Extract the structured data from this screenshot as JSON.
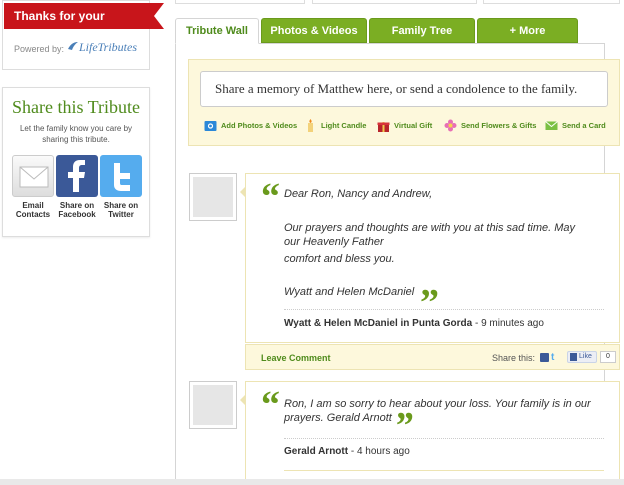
{
  "sidebar": {
    "support_ribbon": "Thanks for your support!",
    "powered_by": "Powered by:",
    "logo_text": "LifeTributes",
    "share_title": "Share this Tribute",
    "share_subtitle": "Let the family know you care by sharing this tribute.",
    "share_buttons": [
      {
        "label": "Email Contacts",
        "icon": "email-icon"
      },
      {
        "label": "Share on Facebook",
        "icon": "facebook-icon"
      },
      {
        "label": "Share on Twitter",
        "icon": "twitter-icon"
      }
    ]
  },
  "tabs": [
    {
      "label": "Tribute Wall",
      "active": true
    },
    {
      "label": "Photos & Videos",
      "active": false
    },
    {
      "label": "Family Tree",
      "active": false
    },
    {
      "label": "+ More",
      "active": false
    }
  ],
  "memory": {
    "placeholder": "Share a memory of Matthew here, or send a condolence to the family.",
    "actions": [
      {
        "label": "Add Photos & Videos",
        "icon": "camera-icon"
      },
      {
        "label": "Light Candle",
        "icon": "candle-icon"
      },
      {
        "label": "Virtual Gift",
        "icon": "gift-icon"
      },
      {
        "label": "Send Flowers & Gifts",
        "icon": "flower-icon"
      },
      {
        "label": "Send a Card",
        "icon": "envelope-icon"
      }
    ]
  },
  "posts": [
    {
      "lines": [
        "Dear Ron, Nancy and Andrew,",
        "Our prayers and thoughts are with you at this sad time. May our Heavenly Father",
        "comfort and bless you.",
        "Wyatt and Helen McDaniel"
      ],
      "author": "Wyatt & Helen McDaniel in Punta Gorda",
      "time": " - 9 minutes ago",
      "leave_comment": "Leave Comment",
      "share_this": "Share this:",
      "like_label": "Like",
      "like_count": "0"
    },
    {
      "lines": [
        "Ron, I am so sorry to hear about your loss. Your family is in our prayers. Gerald Arnott"
      ],
      "author": "Gerald Arnott",
      "time": " - 4 hours ago"
    }
  ],
  "colors": {
    "brand_green": "#7bae23",
    "ribbon_red": "#c8151b",
    "panel_cream": "#fdf8dc"
  }
}
